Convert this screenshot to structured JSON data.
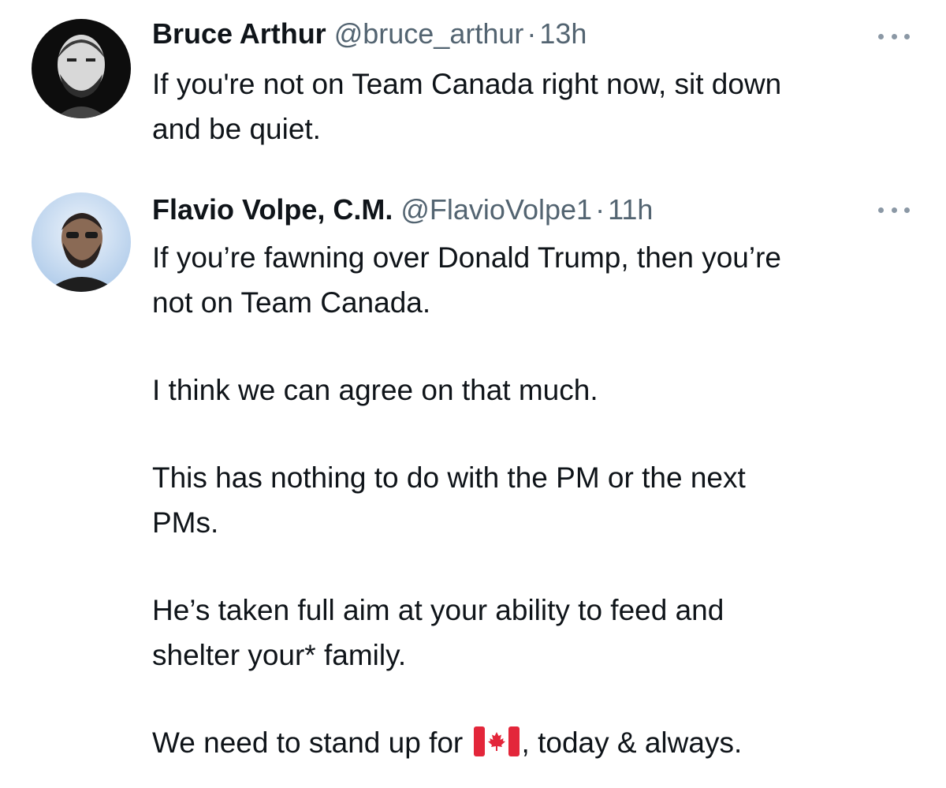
{
  "tweets": [
    {
      "display_name": "Bruce Arthur",
      "handle": "@bruce_arthur",
      "separator": "·",
      "time": "13h",
      "text_lines": [
        "If you're not on Team Canada right now, sit down",
        "and be quiet."
      ]
    },
    {
      "display_name": "Flavio Volpe, C.M.",
      "handle": "@FlavioVolpe1",
      "separator": "·",
      "time": "11h",
      "paragraphs": [
        [
          "If you’re fawning over Donald Trump, then you’re",
          "not on Team Canada."
        ],
        [
          "I think we can agree on that much."
        ],
        [
          "This has nothing to do with the PM or the next",
          "PMs."
        ],
        [
          "He’s taken full aim at your ability to feed and",
          "shelter your* family."
        ]
      ],
      "last_line_before_flag": "We need to stand up for",
      "last_line_flag_icon": "canada-flag-icon",
      "last_line_after_flag": ", today & always."
    }
  ],
  "colors": {
    "text": "#0f1419",
    "secondary": "#536471",
    "flag_red": "#e3263a"
  }
}
